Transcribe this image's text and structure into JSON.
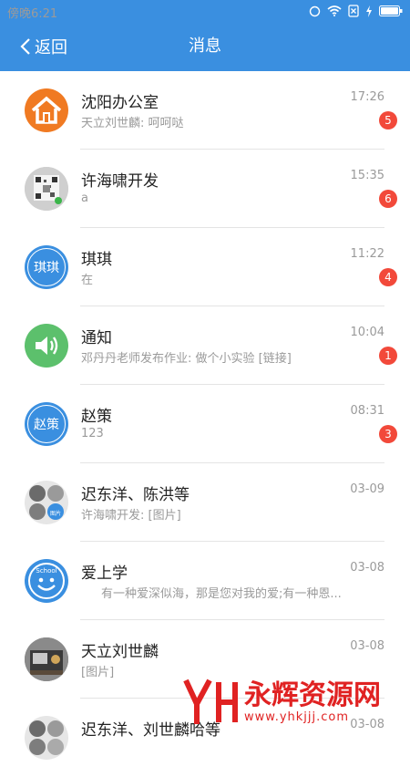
{
  "status_bar": {
    "time": "傍晚6:21"
  },
  "header": {
    "back_label": "返回",
    "title": "消息"
  },
  "conversations": [
    {
      "name": "沈阳办公室",
      "preview": "天立刘世麟: 呵呵哒",
      "time": "17:26",
      "badge": "5",
      "avatar": "house-icon"
    },
    {
      "name": "许海啸开发",
      "preview": "a",
      "time": "15:35",
      "badge": "6",
      "avatar": "photo"
    },
    {
      "name": "琪琪",
      "preview": "在",
      "time": "11:22",
      "badge": "4",
      "avatar_text": "琪琪"
    },
    {
      "name": "通知",
      "preview": "邓丹丹老师发布作业: 做个小实验 [链接]",
      "time": "10:04",
      "badge": "1",
      "avatar": "speaker-icon"
    },
    {
      "name": "赵策",
      "preview": "123",
      "time": "08:31",
      "badge": "3",
      "avatar_text": "赵策"
    },
    {
      "name": "迟东洋、陈洪等",
      "preview": "许海啸开发: [图片]",
      "time": "03-09",
      "avatar": "group",
      "group_tile_text": "图片"
    },
    {
      "name": "爱上学",
      "preview": "有一种爱深似海，那是您对我的爱;有一种恩...",
      "time": "03-08",
      "avatar": "smiley-icon",
      "avatar_badge_text": "School"
    },
    {
      "name": "天立刘世麟",
      "preview": "[图片]",
      "time": "03-08",
      "avatar": "photo"
    },
    {
      "name": "迟东洋、刘世麟哈等",
      "preview": "",
      "time": "03-08",
      "avatar": "group"
    }
  ],
  "watermark": {
    "big": "永辉资源网",
    "small": "www.yhkjjj.com"
  },
  "colors": {
    "primary": "#3a8fe0",
    "badge": "#f2493a",
    "house": "#f07a22",
    "speaker": "#5cc06c"
  }
}
